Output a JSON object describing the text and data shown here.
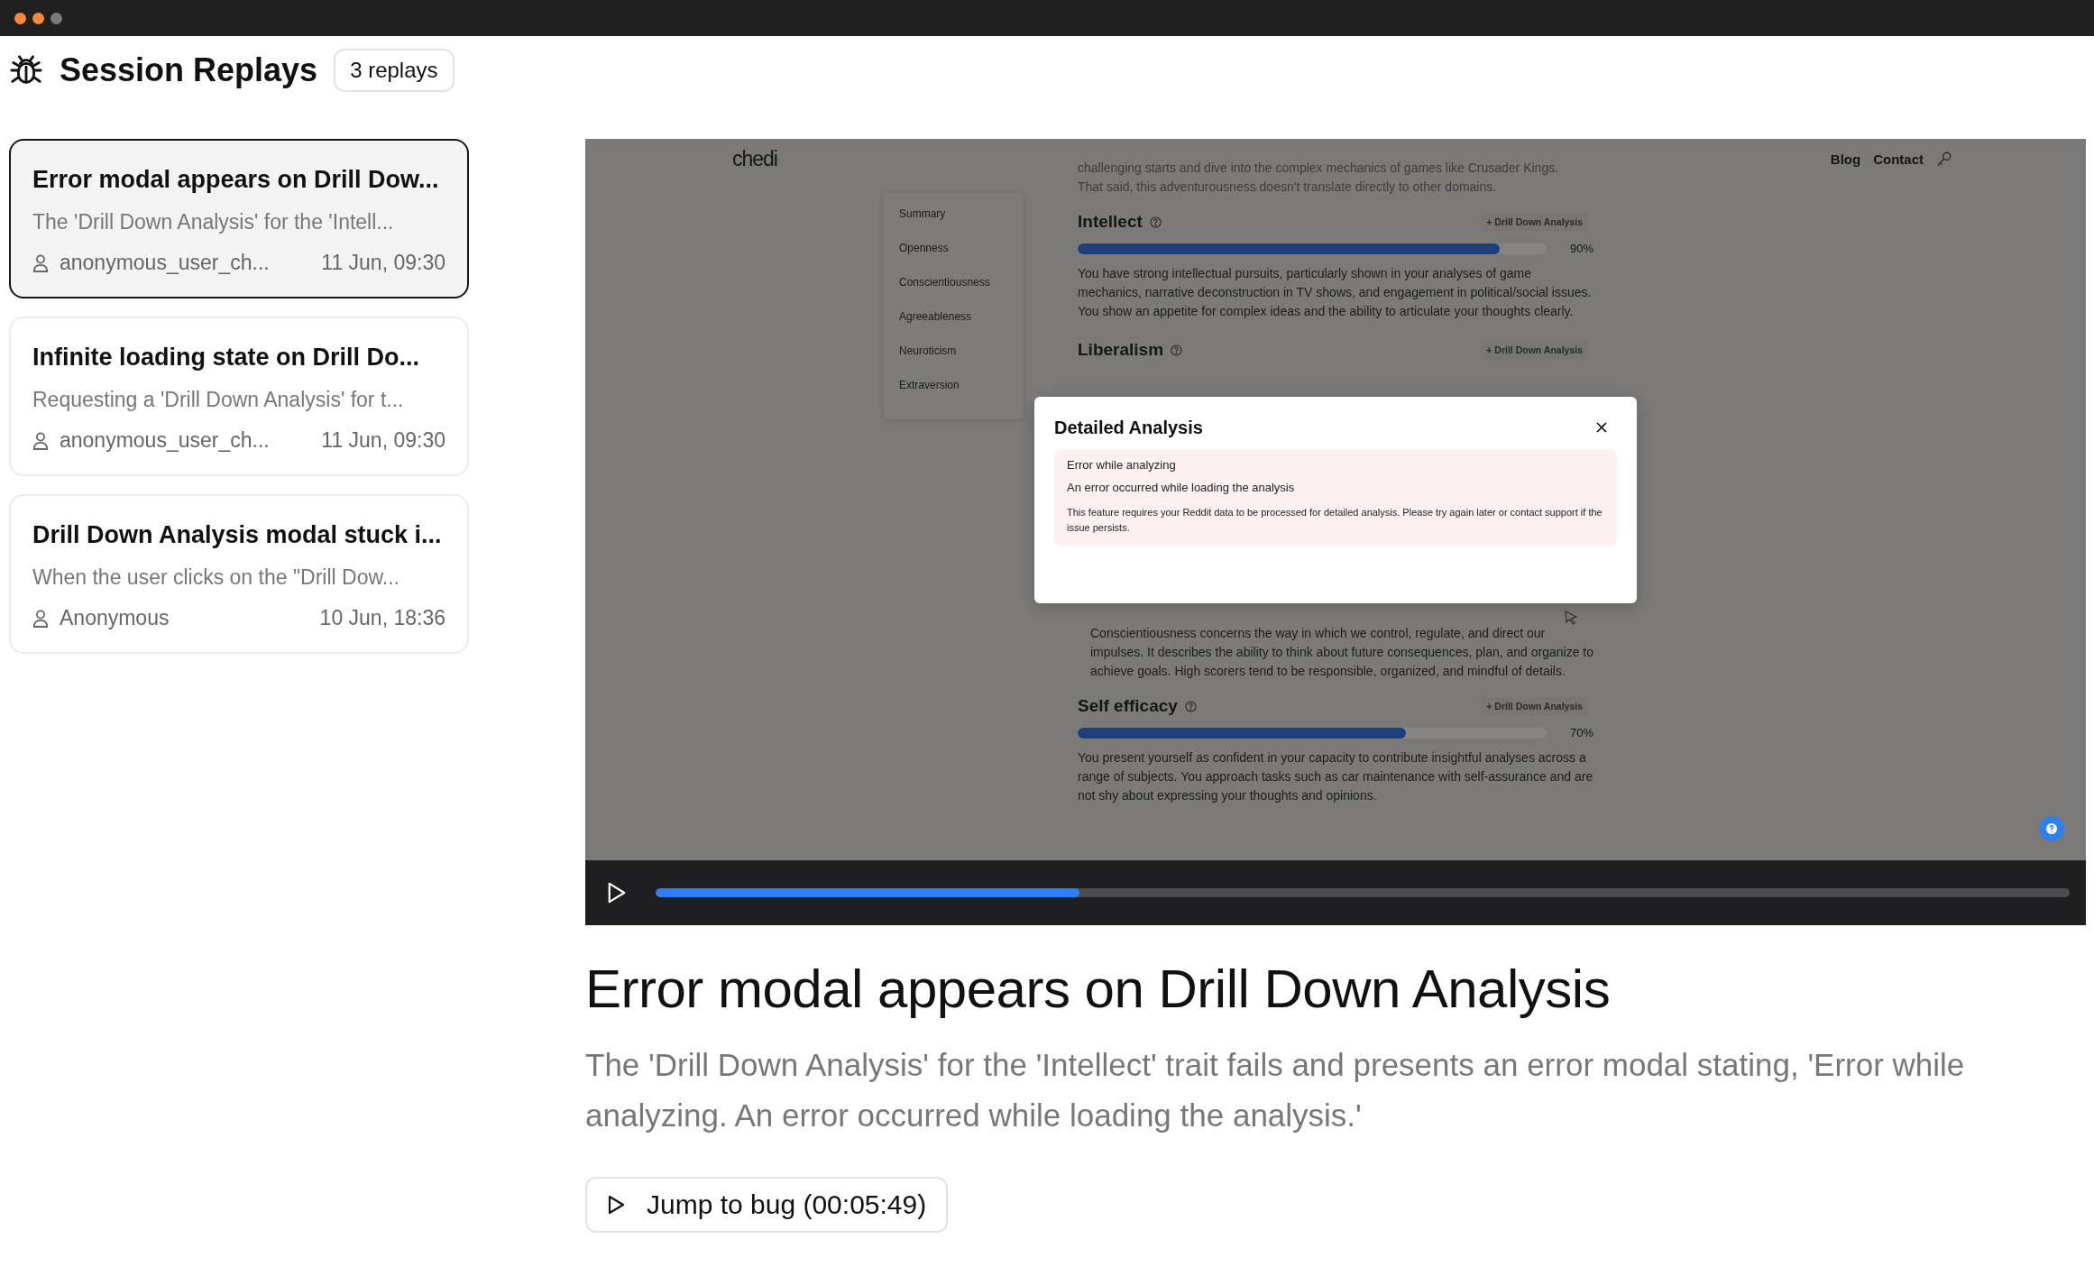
{
  "header": {
    "title": "Session Replays",
    "badge": "3 replays"
  },
  "replays": [
    {
      "title": "Error modal appears on Drill Dow...",
      "summary": "The 'Drill Down Analysis' for the 'Intell...",
      "user": "anonymous_user_ch...",
      "time": "11 Jun, 09:30",
      "selected": true
    },
    {
      "title": "Infinite loading state on Drill Do...",
      "summary": "Requesting a 'Drill Down Analysis' for t...",
      "user": "anonymous_user_ch...",
      "time": "11 Jun, 09:30",
      "selected": false
    },
    {
      "title": "Drill Down Analysis modal stuck i...",
      "summary": "When the user clicks on the \"Drill Dow...",
      "user": "Anonymous",
      "time": "10 Jun, 18:36",
      "selected": false
    }
  ],
  "player": {
    "page": {
      "logo": "chedi",
      "nav": [
        "Blog",
        "Contact"
      ],
      "side_nav": [
        "Summary",
        "Openness",
        "Conscientiousness",
        "Agreeableness",
        "Neuroticism",
        "Extraversion"
      ],
      "blocks": [
        {
          "kind": "faded_text",
          "text": "challenging starts and dive into the complex mechanics of games like Crusader Kings. That said, this adventurousness doesn't translate directly to other domains."
        },
        {
          "kind": "trait",
          "name": "Intellect",
          "action": "+ Drill Down Analysis",
          "level": 0.9,
          "reading": "90%",
          "text": "You have strong intellectual pursuits, particularly shown in your analyses of game mechanics, narrative deconstruction in TV shows, and engagement in political/social issues. You show an appetite for complex ideas and the ability to articulate your thoughts clearly."
        },
        {
          "kind": "trait_heading",
          "name": "Liberalism",
          "action": "+ Drill Down Analysis"
        },
        {
          "kind": "note",
          "text": "Conscientiousness concerns the way in which we control, regulate, and direct our impulses. It describes the ability to think about future consequences, plan, and organize to achieve goals. High scorers tend to be responsible, organized, and mindful of details."
        },
        {
          "kind": "trait",
          "name": "Self efficacy",
          "action": "+ Drill Down Analysis",
          "level": 0.7,
          "reading": "70%",
          "text": "You present yourself as confident in your capacity to contribute insightful analyses across a range of subjects. You approach tasks such as car maintenance with self-assurance and are not shy about expressing your thoughts and opinions."
        }
      ]
    },
    "modal": {
      "title": "Detailed Analysis",
      "error_title": "Error while analyzing",
      "error_message": "An error occurred while loading the analysis",
      "detail": "This feature requires your Reddit data to be processed for detailed analysis. Please try again later or contact support if the issue persists."
    },
    "progress": {
      "level": 0.3
    }
  },
  "detail": {
    "title": "Error modal appears on Drill Down Analysis",
    "description": "The 'Drill Down Analysis' for the 'Intellect' trait fails and presents an error modal stating, 'Error while analyzing. An error occurred while loading the analysis.'",
    "jump_button": "Jump to bug (00:05:49)"
  }
}
